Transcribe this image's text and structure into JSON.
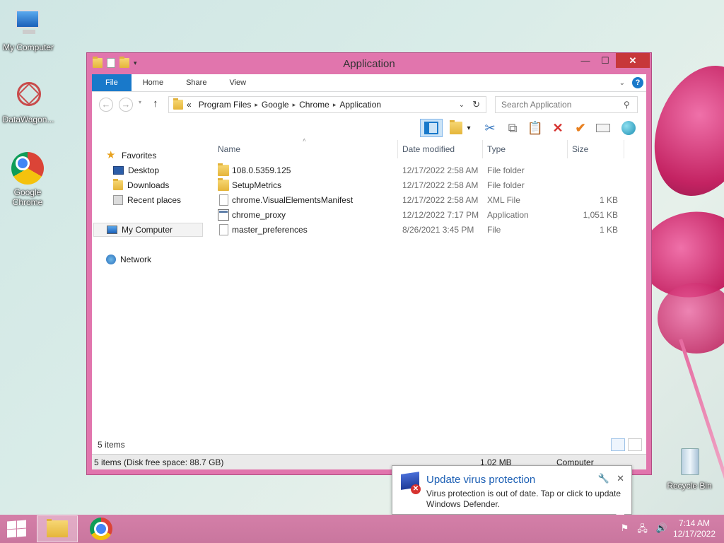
{
  "desktop": {
    "icons": [
      {
        "label": "My Computer"
      },
      {
        "label": "DataWagon..."
      },
      {
        "label": "Google Chrome"
      },
      {
        "label": "Recycle Bin"
      }
    ]
  },
  "window": {
    "title": "Application",
    "ribbon_tabs": [
      "File",
      "Home",
      "Share",
      "View"
    ],
    "help": "?",
    "address": {
      "prefix": "«",
      "segments": [
        "Program Files",
        "Google",
        "Chrome",
        "Application"
      ]
    },
    "search_placeholder": "Search Application",
    "nav": {
      "favorites": "Favorites",
      "desktop": "Desktop",
      "downloads": "Downloads",
      "recent": "Recent places",
      "computer": "My Computer",
      "network": "Network"
    },
    "columns": [
      "Name",
      "Date modified",
      "Type",
      "Size"
    ],
    "files": [
      {
        "name": "108.0.5359.125",
        "date": "12/17/2022 2:58 AM",
        "type": "File folder",
        "size": "",
        "kind": "folder"
      },
      {
        "name": "SetupMetrics",
        "date": "12/17/2022 2:58 AM",
        "type": "File folder",
        "size": "",
        "kind": "folder"
      },
      {
        "name": "chrome.VisualElementsManifest",
        "date": "12/17/2022 2:58 AM",
        "type": "XML File",
        "size": "1 KB",
        "kind": "file"
      },
      {
        "name": "chrome_proxy",
        "date": "12/12/2022 7:17 PM",
        "type": "Application",
        "size": "1,051 KB",
        "kind": "app"
      },
      {
        "name": "master_preferences",
        "date": "8/26/2021 3:45 PM",
        "type": "File",
        "size": "1 KB",
        "kind": "file"
      }
    ],
    "status_items": "5 items",
    "status_bottom": "5 items (Disk free space: 88.7 GB)",
    "status_size": "1.02 MB",
    "status_location": "Computer"
  },
  "notification": {
    "title": "Update virus protection",
    "message": "Virus protection is out of date. Tap or click to update Windows Defender."
  },
  "taskbar": {
    "time": "7:14 AM",
    "date": "12/17/2022"
  },
  "colors": {
    "window_frame": "#e175ad",
    "accent": "#1979ca",
    "close": "#c7373a"
  }
}
